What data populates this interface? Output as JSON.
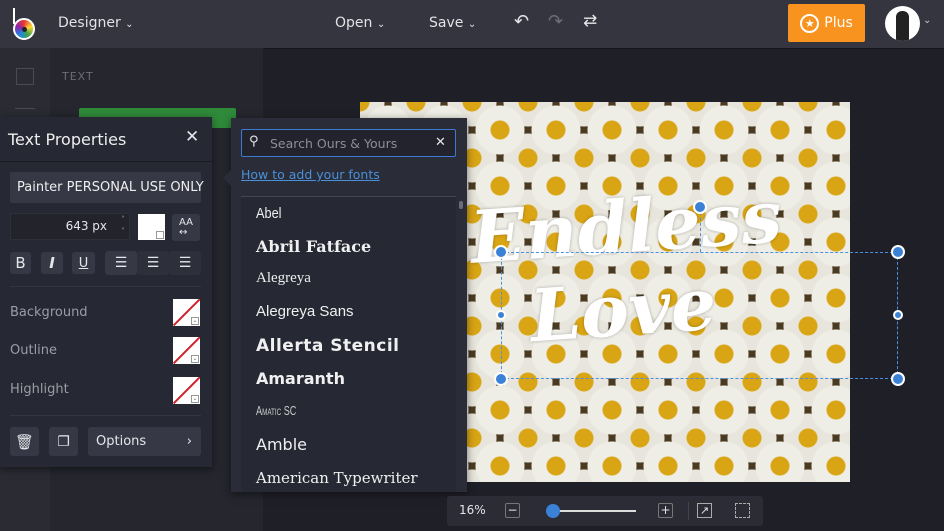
{
  "topbar": {
    "app_menu": "Designer",
    "open": "Open",
    "save": "Save",
    "plus": "Plus"
  },
  "left_panel": {
    "section_title": "TEXT"
  },
  "canvas": {
    "line1": "Endless",
    "line2": "Love"
  },
  "text_properties": {
    "title": "Text Properties",
    "font_name": "Painter PERSONAL USE ONLY",
    "font_size": "643 px",
    "text_color": "#ffffff",
    "style_buttons": [
      "B",
      "I",
      "U"
    ],
    "rows": [
      {
        "label": "Background"
      },
      {
        "label": "Outline"
      },
      {
        "label": "Highlight"
      }
    ],
    "options_label": "Options"
  },
  "font_dropdown": {
    "search_placeholder": "Search Ours & Yours",
    "help_link": "How to add your fonts",
    "fonts": [
      "Abel",
      "Abril Fatface",
      "Alegreya",
      "Alegreya Sans",
      "Allerta Stencil",
      "Amaranth",
      "Amatic SC",
      "Amble",
      "American Typewriter"
    ]
  },
  "zoom": {
    "level": "16%",
    "slider_fraction": 0.03
  },
  "colors": {
    "accent": "#f7931e",
    "selection": "#3b82d6",
    "link": "#4a90d9"
  }
}
